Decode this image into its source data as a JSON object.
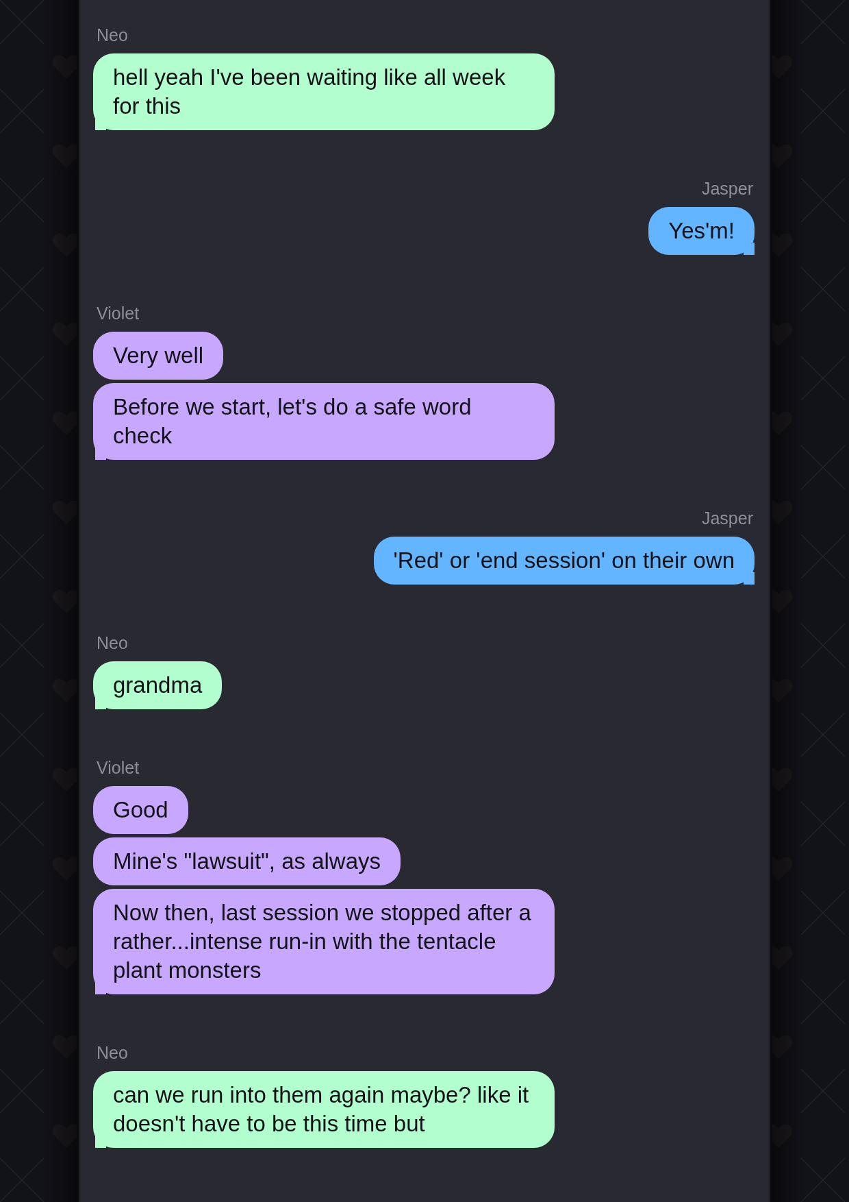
{
  "chat": {
    "groups": [
      {
        "sender": "Neo",
        "outgoing": false,
        "color": "#b3fecf",
        "messages": [
          "hell yeah I've been waiting like all week for this"
        ]
      },
      {
        "sender": "Jasper",
        "outgoing": true,
        "color": "#64b5ff",
        "messages": [
          "Yes'm!"
        ]
      },
      {
        "sender": "Violet",
        "outgoing": false,
        "color": "#c7a8fe",
        "messages": [
          "Very well",
          "Before we start, let's do a safe word check"
        ]
      },
      {
        "sender": "Jasper",
        "outgoing": true,
        "color": "#64b5ff",
        "messages": [
          "'Red' or 'end session' on their own"
        ]
      },
      {
        "sender": "Neo",
        "outgoing": false,
        "color": "#b3fecf",
        "messages": [
          "grandma"
        ]
      },
      {
        "sender": "Violet",
        "outgoing": false,
        "color": "#c7a8fe",
        "messages": [
          "Good",
          "Mine's \"lawsuit\", as always",
          "Now then, last session we stopped after a rather...intense run-in with the tentacle plant monsters"
        ]
      },
      {
        "sender": "Neo",
        "outgoing": false,
        "color": "#b3fecf",
        "messages": [
          "can we run into them again maybe? like it doesn't have to be this time but"
        ]
      }
    ]
  }
}
